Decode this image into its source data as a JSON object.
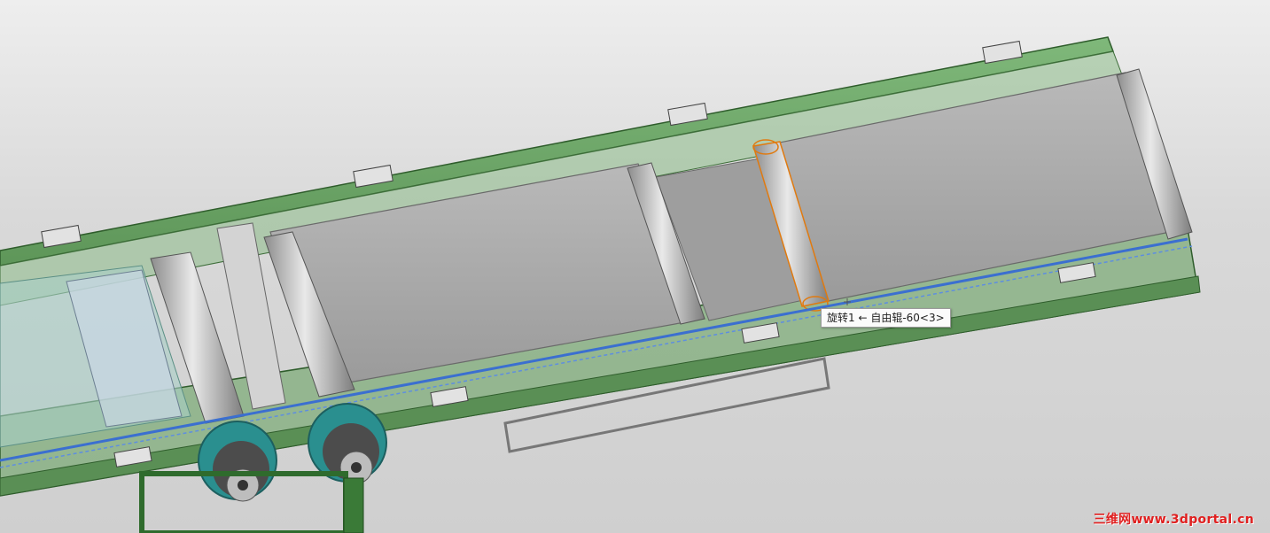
{
  "tooltip": {
    "text": "旋转1 ← 自由辊-60<3>"
  },
  "watermark": {
    "text": "三维网www.3dportal.cn"
  },
  "colors": {
    "frame_green": "#6fa86a",
    "frame_dark_green": "#2f6b2d",
    "belt_gray": "#a7a7a7",
    "roller_gray": "#c8c8c8",
    "highlight_orange": "#e07a10",
    "belt_blue": "#3b6fd0",
    "pulley_teal": "#2a8f8f",
    "watermark_red": "#e02020"
  },
  "icons": [
    "conveyor-frame",
    "conveyor-belt",
    "idler-roller",
    "drive-pulley",
    "mounting-bracket"
  ]
}
